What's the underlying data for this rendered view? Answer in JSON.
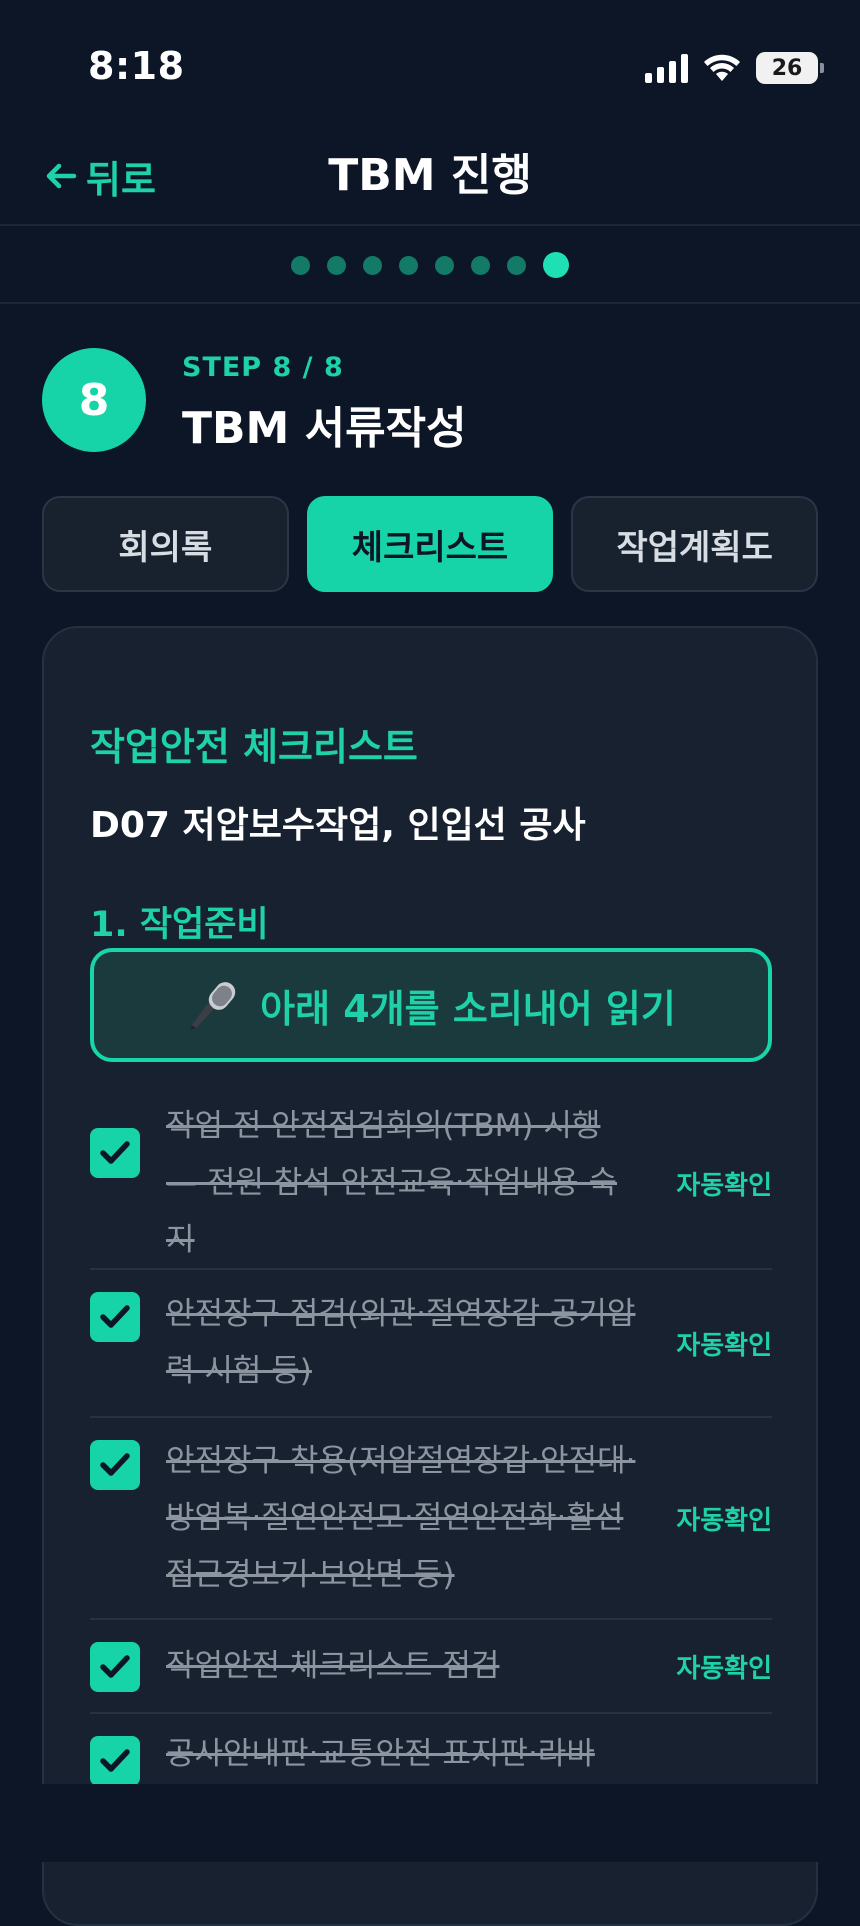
{
  "status_bar": {
    "time": "8:18",
    "battery": "26"
  },
  "nav": {
    "back_label": "뒤로",
    "title": "TBM 진행"
  },
  "progress": {
    "total_steps": 8,
    "current_step": 8
  },
  "step": {
    "number": "8",
    "label": "STEP 8 / 8",
    "title": "TBM 서류작성"
  },
  "tabs": [
    {
      "label": "회의록",
      "active": false
    },
    {
      "label": "체크리스트",
      "active": true
    },
    {
      "label": "작업계획도",
      "active": false
    }
  ],
  "card": {
    "title": "작업안전 체크리스트",
    "subtitle": "D07 저압보수작업, 인입선 공사",
    "section_title": "1. 작업준비",
    "read_aloud_label": "아래 4개를 소리내어 읽기",
    "items": [
      {
        "text": "작업 전 안전점검회의(TBM) 시행 — 전원 참석 안전교육·작업내용 숙지",
        "badge": "자동확인",
        "checked": true
      },
      {
        "text": "안전장구 점검(외관·절연장갑 공기압력 시험 등)",
        "badge": "자동확인",
        "checked": true
      },
      {
        "text": "안전장구 착용(저압절연장갑·안전대·방염복·절연안전모·절연안전화·활선접근경보기·보안면 등)",
        "badge": "자동확인",
        "checked": true
      },
      {
        "text": "작업안전 체크리스트 점검",
        "badge": "자동확인",
        "checked": true
      },
      {
        "text": "공사안내판·교통안전 표지판·라바",
        "badge": "",
        "checked": true
      }
    ]
  },
  "colors": {
    "accent": "#16d3a8",
    "background": "#0c1626",
    "card": "#172130"
  }
}
